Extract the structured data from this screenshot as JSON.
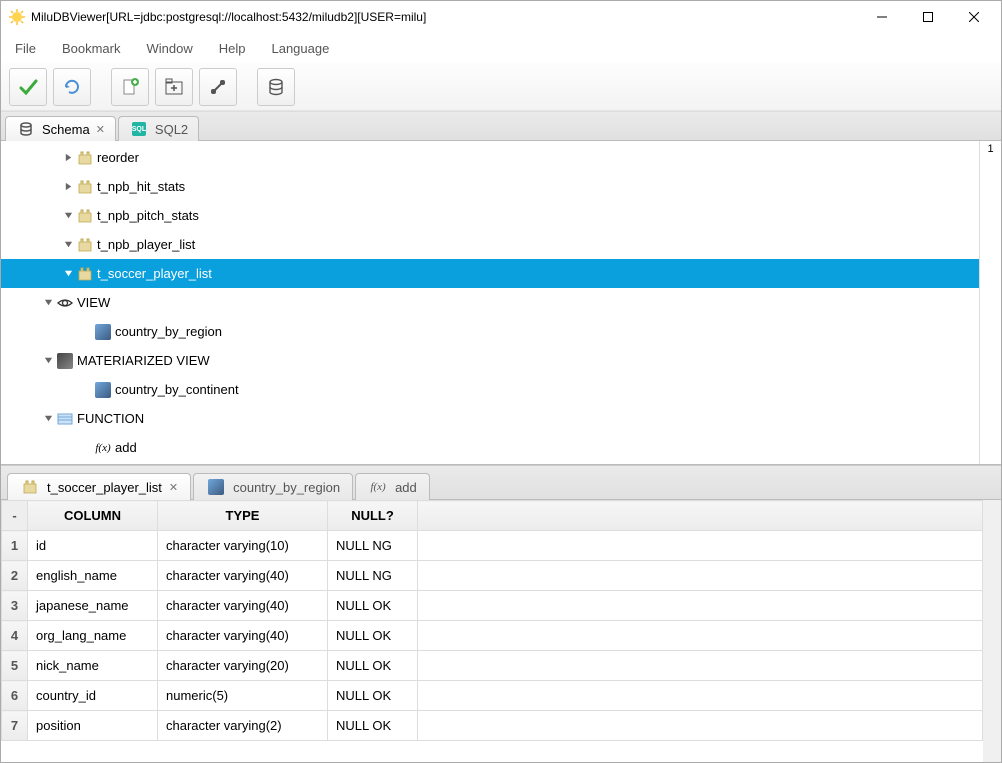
{
  "window": {
    "title": "MiluDBViewer[URL=jdbc:postgresql://localhost:5432/miludb2][USER=milu]"
  },
  "menu": {
    "items": [
      "File",
      "Bookmark",
      "Window",
      "Help",
      "Language"
    ]
  },
  "toolbar": {
    "buttons": [
      "confirm",
      "refresh",
      "new-document",
      "add-tab",
      "connect",
      "database"
    ]
  },
  "upper_tabs": [
    {
      "label": "Schema",
      "icon": "db",
      "closable": true,
      "active": true
    },
    {
      "label": "SQL2",
      "icon": "sql",
      "closable": false,
      "active": false
    }
  ],
  "tree": {
    "counter": "1",
    "nodes": [
      {
        "indent": 60,
        "arrow": "right",
        "icon": "table",
        "label": "reorder",
        "selected": false
      },
      {
        "indent": 60,
        "arrow": "right",
        "icon": "table",
        "label": "t_npb_hit_stats",
        "selected": false
      },
      {
        "indent": 60,
        "arrow": "down",
        "icon": "table",
        "label": "t_npb_pitch_stats",
        "selected": false
      },
      {
        "indent": 60,
        "arrow": "down",
        "icon": "table",
        "label": "t_npb_player_list",
        "selected": false
      },
      {
        "indent": 60,
        "arrow": "down",
        "icon": "table",
        "label": "t_soccer_player_list",
        "selected": true
      },
      {
        "indent": 40,
        "arrow": "down",
        "icon": "eye",
        "label": "VIEW",
        "selected": false
      },
      {
        "indent": 78,
        "arrow": "",
        "icon": "img",
        "label": "country_by_region",
        "selected": false
      },
      {
        "indent": 40,
        "arrow": "down",
        "icon": "imgdark",
        "label": "MATERIARIZED VIEW",
        "selected": false
      },
      {
        "indent": 78,
        "arrow": "",
        "icon": "img",
        "label": "country_by_continent",
        "selected": false
      },
      {
        "indent": 40,
        "arrow": "down",
        "icon": "fnlist",
        "label": "FUNCTION",
        "selected": false
      },
      {
        "indent": 78,
        "arrow": "",
        "icon": "fn",
        "label": "add",
        "selected": false
      }
    ]
  },
  "lower_tabs": [
    {
      "label": "t_soccer_player_list",
      "icon": "table",
      "closable": true,
      "active": true
    },
    {
      "label": "country_by_region",
      "icon": "img",
      "closable": false,
      "active": false
    },
    {
      "label": "add",
      "icon": "fn",
      "closable": false,
      "active": false
    }
  ],
  "table": {
    "headers": {
      "rownum": "-",
      "col": "COLUMN",
      "type": "TYPE",
      "null": "NULL?"
    },
    "rows": [
      {
        "n": "1",
        "col": "id",
        "type": "character varying(10)",
        "null": "NULL NG"
      },
      {
        "n": "2",
        "col": "english_name",
        "type": "character varying(40)",
        "null": "NULL NG"
      },
      {
        "n": "3",
        "col": "japanese_name",
        "type": "character varying(40)",
        "null": "NULL OK"
      },
      {
        "n": "4",
        "col": "org_lang_name",
        "type": "character varying(40)",
        "null": "NULL OK"
      },
      {
        "n": "5",
        "col": "nick_name",
        "type": "character varying(20)",
        "null": "NULL OK"
      },
      {
        "n": "6",
        "col": "country_id",
        "type": "numeric(5)",
        "null": "NULL OK"
      },
      {
        "n": "7",
        "col": "position",
        "type": "character varying(2)",
        "null": "NULL OK"
      }
    ]
  }
}
